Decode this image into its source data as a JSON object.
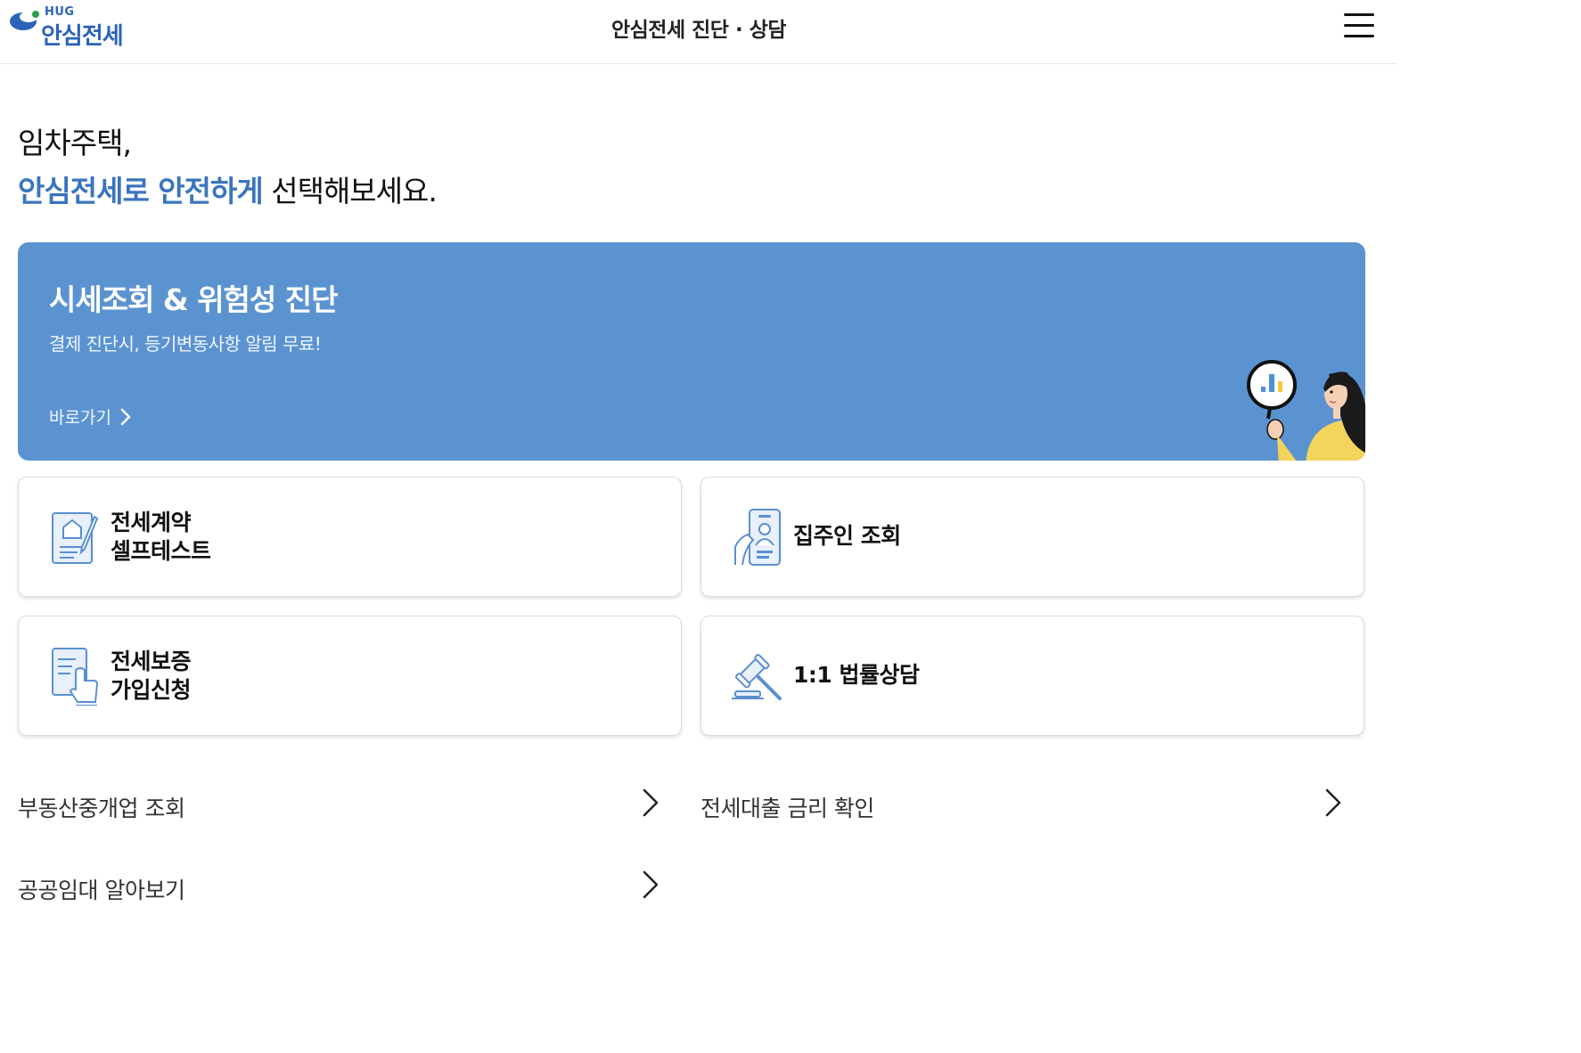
{
  "header": {
    "logo_sup": "HUG",
    "logo_text": "안심전세",
    "title": "안심전세 진단 · 상담"
  },
  "headline": {
    "line1": "임차주택,",
    "line2_accent": "안심전세로 안전하게",
    "line2_rest": " 선택해보세요."
  },
  "banner": {
    "title": "시세조회 & 위험성 진단",
    "subtitle": "결제 진단시, 등기변동사항 알림 무료!",
    "link_label": "바로가기"
  },
  "cards": [
    {
      "line1": "전세계약",
      "line2": "셀프테스트",
      "icon": "contract-document-icon"
    },
    {
      "line1": "집주인 조회",
      "line2": "",
      "icon": "landlord-id-icon"
    },
    {
      "line1": "전세보증",
      "line2": "가입신청",
      "icon": "application-form-icon"
    },
    {
      "line1": "1:1 법률상담",
      "line2": "",
      "icon": "gavel-icon"
    }
  ],
  "links": [
    {
      "label": "부동산중개업 조회"
    },
    {
      "label": "전세대출 금리 확인"
    },
    {
      "label": "공공임대 알아보기"
    }
  ],
  "colors": {
    "brand": "#2b63b8",
    "accent_text": "#3a74bd",
    "banner_bg": "#5b93d1",
    "icon_stroke": "#5b8fd0"
  }
}
